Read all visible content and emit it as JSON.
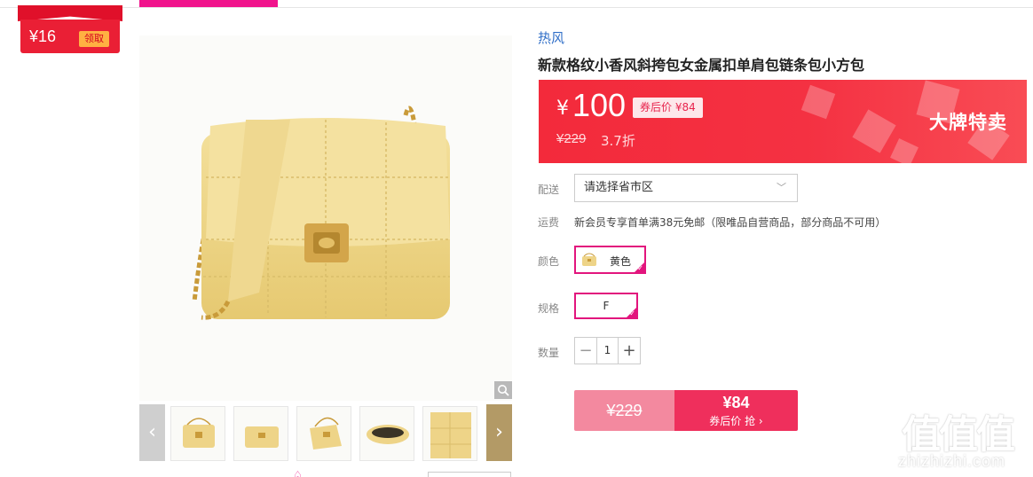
{
  "coupon": {
    "amount": "¥16",
    "get_label": "领取"
  },
  "product": {
    "tag": "热风",
    "title": "新款格纹小香风斜挎包女金属扣单肩包链条包小方包",
    "price_symbol": "¥",
    "price": "100",
    "after_coupon_price": "券后价 ¥84",
    "original_price": "¥229",
    "discount": "3.7折",
    "banner_text": "大牌特卖"
  },
  "delivery": {
    "label": "配送",
    "placeholder": "请选择省市区"
  },
  "shipping": {
    "label": "运费",
    "text": "新会员专享首单满38元免邮（限唯品自营商品，部分商品不可用）"
  },
  "color": {
    "label": "颜色",
    "selected": "黄色"
  },
  "size": {
    "label": "规格",
    "selected": "F"
  },
  "quantity": {
    "label": "数量",
    "value": "1",
    "minus": "−",
    "plus": "+"
  },
  "buy": {
    "original_price": "¥229",
    "price": "¥84",
    "action": "券后价 抢 ›"
  },
  "thumbnails": [
    "thumb-1",
    "thumb-2",
    "thumb-3",
    "thumb-4",
    "thumb-5",
    "thumb-6"
  ],
  "watermark": {
    "logo": "值值值",
    "url": "zhizhizhi.com"
  },
  "colors": {
    "accent": "#f0138c",
    "price_red": "#f32a3b",
    "buy_pink": "#ef2f5c",
    "link_blue": "#2f6ec7"
  }
}
